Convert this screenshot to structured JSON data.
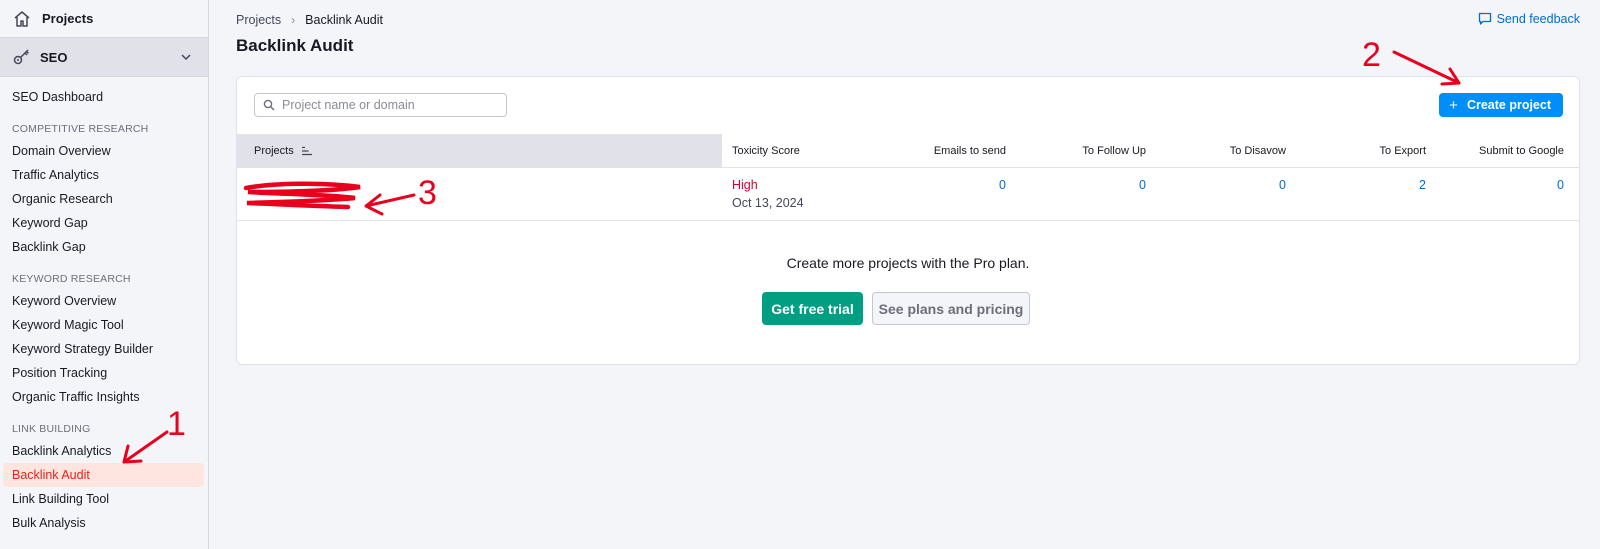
{
  "sidebar": {
    "projects_label": "Projects",
    "seo_label": "SEO",
    "dashboard": "SEO Dashboard",
    "sections": [
      {
        "title": "COMPETITIVE RESEARCH",
        "items": [
          "Domain Overview",
          "Traffic Analytics",
          "Organic Research",
          "Keyword Gap",
          "Backlink Gap"
        ]
      },
      {
        "title": "KEYWORD RESEARCH",
        "items": [
          "Keyword Overview",
          "Keyword Magic Tool",
          "Keyword Strategy Builder",
          "Position Tracking",
          "Organic Traffic Insights"
        ]
      },
      {
        "title": "LINK BUILDING",
        "items": [
          "Backlink Analytics",
          "Backlink Audit",
          "Link Building Tool",
          "Bulk Analysis"
        ]
      }
    ],
    "active_item": "Backlink Audit"
  },
  "breadcrumb": {
    "root": "Projects",
    "current": "Backlink Audit"
  },
  "page_title": "Backlink Audit",
  "feedback_label": "Send feedback",
  "search": {
    "placeholder": "Project name or domain",
    "value": ""
  },
  "create_button": "Create project",
  "table": {
    "headers": {
      "projects": "Projects",
      "toxicity": "Toxicity Score",
      "emails": "Emails to send",
      "follow_up": "To Follow Up",
      "disavow": "To Disavow",
      "export": "To Export",
      "submit": "Submit to Google"
    },
    "row": {
      "toxicity_level": "High",
      "date": "Oct 13, 2024",
      "emails": "0",
      "follow_up": "0",
      "disavow": "0",
      "export": "2",
      "submit": "0"
    }
  },
  "upsell": {
    "text": "Create more projects with the Pro plan.",
    "trial_button": "Get free trial",
    "plans_button": "See plans and pricing"
  },
  "annotations": [
    "1",
    "2",
    "3"
  ],
  "colors": {
    "accent_blue": "#008ff8",
    "link_blue": "#006dca",
    "trial_green": "#009f81",
    "active_red": "#e8231a",
    "annotation_red": "#e8001c"
  }
}
